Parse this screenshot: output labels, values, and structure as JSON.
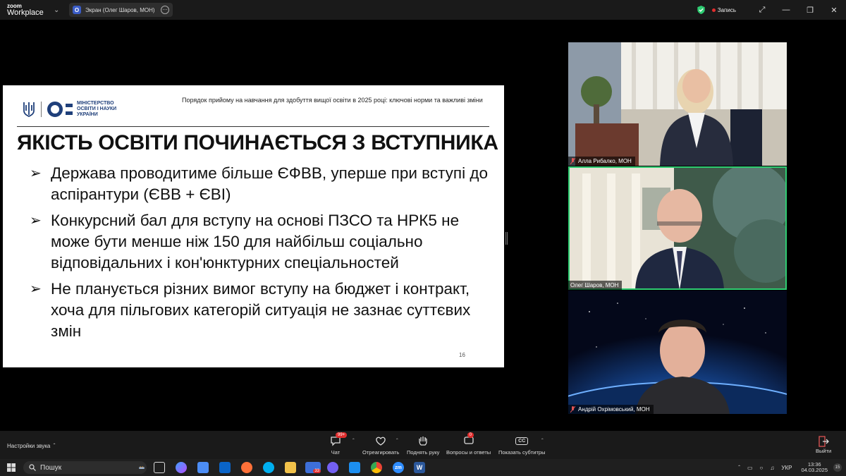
{
  "titlebar": {
    "brand_top": "zoom",
    "brand_bottom": "Workplace",
    "share_icon_letter": "O",
    "share_label": "Экран (Олег Шаров, МОН)",
    "recording_label": "Запись"
  },
  "slide": {
    "org_line1": "МІНІСТЕРСТВО",
    "org_line2": "ОСВІТИ І НАУКИ",
    "org_line3": "УКРАЇНИ",
    "header": "Порядок прийому на навчання для здобуття вищої освіти в 2025 році: ключові норми та важливі зміни",
    "title": "ЯКІСТЬ ОСВІТИ ПОЧИНАЄТЬСЯ З ВСТУПНИКА",
    "bullets": [
      {
        "text": "Держава проводитиме більше ЄФВВ, уперше при вступі до аспірантури (ЄВВ + ЄВІ)"
      },
      {
        "text": "Конкурсний бал для вступу на основі ПЗСО та НРК5 не може бути менше ніж 150 для найбільш соціально відповідальних і кон'юнктурних спеціальностей"
      },
      {
        "text": "Не планується різних вимог вступу на бюджет і контракт, хоча для пільгових категорій ситуація не зазнає суттєвих змін"
      }
    ],
    "page_number": "16"
  },
  "participants": [
    {
      "name": "Алла Рибалко, МОН"
    },
    {
      "name": "Олег Шаров, МОН"
    },
    {
      "name": "Андрій Охрімовський, МОН"
    }
  ],
  "toolbar": {
    "audio_settings": "Настройки звука",
    "chat_label": "Чат",
    "chat_badge": "99+",
    "react_label": "Отреагировать",
    "raise_hand_label": "Поднять руку",
    "qa_label": "Вопросы и ответы",
    "qa_badge": "0",
    "captions_label": "Показать субтитры",
    "captions_icon_text": "CC",
    "exit_label": "Выйти"
  },
  "taskbar": {
    "search_label": "Пошук",
    "app_badge": "33",
    "zm_label": "zm",
    "word_label": "W",
    "language": "УКР",
    "time": "13:36",
    "date": "04.03.2025",
    "notification_count": "15"
  },
  "colors": {
    "ministry_blue": "#1f3f7a",
    "active_speaker": "#2ecc71",
    "recording_red": "#e02d2d",
    "toolbar_bg": "#1a1a1a"
  }
}
